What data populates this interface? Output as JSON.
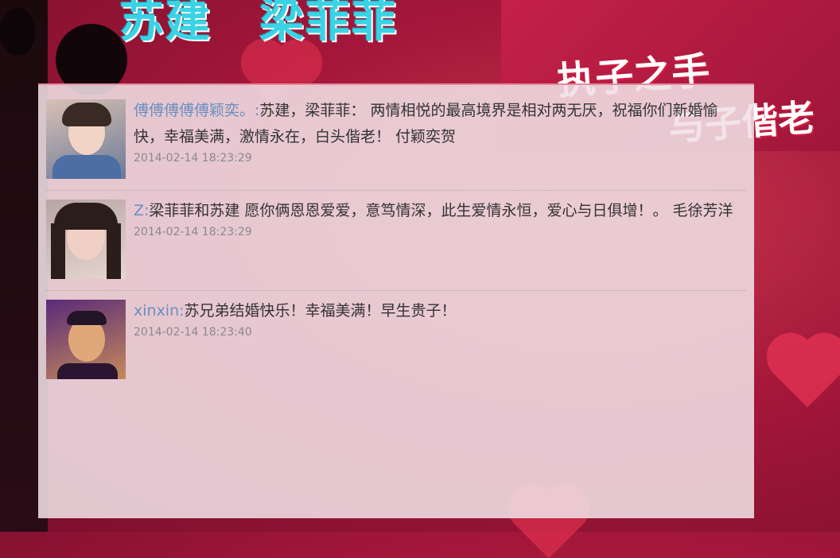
{
  "header": {
    "names": [
      "苏建",
      "梁菲菲"
    ],
    "banner_line1": "执子之手",
    "banner_line2": "与子偕老"
  },
  "comments": [
    {
      "name": "傅傅傅傅傅颖奕。:",
      "text": "苏建，梁菲菲：  两情相悦的最高境界是相对两无厌，祝福你们新婚愉快，幸福美满，激情永在，白头偕老！ 付颖奕贺",
      "time": "2014-02-14 18:23:29"
    },
    {
      "name": "Z:",
      "text": "梁菲菲和苏建 愿你俩恩恩爱爱，意笃情深，此生爱情永恒，爱心与日俱增！。 毛徐芳洋",
      "time": "2014-02-14 18:23:29"
    },
    {
      "name": "xinxin:",
      "text": "苏兄弟结婚快乐！幸福美满！早生贵子！",
      "time": "2014-02-14 18:23:40"
    }
  ]
}
